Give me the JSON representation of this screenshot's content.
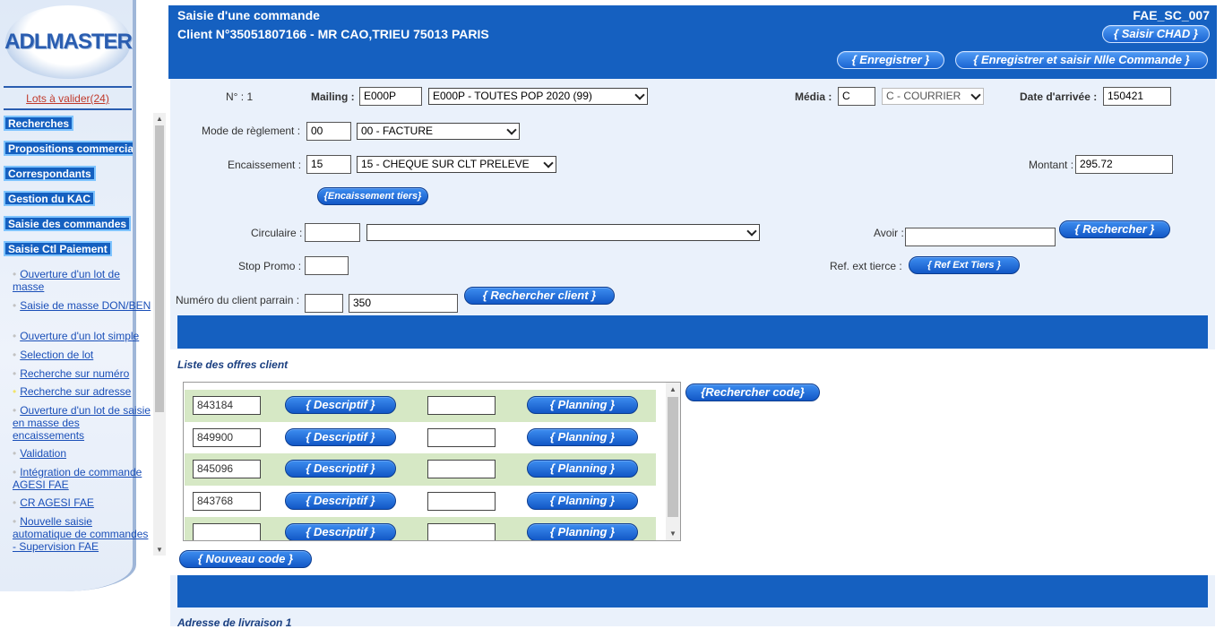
{
  "sidebar": {
    "logo_text": "ADLMASTER",
    "lots_link": "Lots à valider(24)",
    "buttons": [
      "Recherches",
      "Propositions commerciales",
      "Correspondants",
      "Gestion du KAC",
      "Saisie des commandes",
      "Saisie Ctl Paiement"
    ],
    "links": [
      "Ouverture d'un lot de masse",
      "Saisie de masse DON/BEN",
      "Ouverture d'un lot simple",
      "Selection de lot",
      "Recherche sur numéro",
      "Recherche sur adresse",
      "Ouverture d'un lot de saisie en masse des encaissements",
      "Validation",
      "Intégration de commande AGESI FAE",
      "CR AGESI FAE",
      "Nouvelle saisie automatique de commandes - Supervision FAE"
    ]
  },
  "header": {
    "title": "Saisie d'une commande",
    "client": "Client N°35051807166 - MR CAO,TRIEU 75013 PARIS",
    "screen_code": "FAE_SC_007",
    "btn_chad": "{ Saisir CHAD }",
    "btn_save": "{ Enregistrer }",
    "btn_save_new": "{ Enregistrer et saisir Nlle Commande }"
  },
  "form": {
    "num_label": "N° : 1",
    "mailing_label": "Mailing :",
    "mailing_value": "E000P",
    "mailing_select": "E000P - TOUTES POP 2020 (99)",
    "media_label": "Média :",
    "media_value": "C",
    "media_select": "C - COURRIER",
    "date_label": "Date d'arrivée :",
    "date_value": "150421",
    "mode_label": "Mode de règlement :",
    "mode_value": "00",
    "mode_select": "00 - FACTURE",
    "enc_label": "Encaissement :",
    "enc_value": "15",
    "enc_select": "15 - CHEQUE SUR CLT PRELEVE",
    "montant_label": "Montant :",
    "montant_value": "295.72",
    "btn_enc_tiers": "{Encaissement tiers}",
    "circ_label": "Circulaire :",
    "circ_value": "",
    "circ_select": "",
    "avoir_label": "Avoir :",
    "avoir_value": "",
    "btn_rechercher": "{ Rechercher }",
    "stop_label": "Stop Promo :",
    "stop_value": "",
    "ref_label": "Ref. ext tierce :",
    "btn_ref": "{ Ref Ext Tiers }",
    "parrain_label": "Numéro du client parrain :",
    "parrain_value1": "",
    "parrain_value2": "350",
    "btn_rech_client": "{ Rechercher client }"
  },
  "offers": {
    "title": "Liste des offres client",
    "rows": [
      {
        "code": "843184",
        "desc": "{ Descriptif }",
        "plan": "{ Planning }"
      },
      {
        "code": "849900",
        "desc": "{ Descriptif }",
        "plan": "{ Planning }"
      },
      {
        "code": "845096",
        "desc": "{ Descriptif }",
        "plan": "{ Planning }"
      },
      {
        "code": "843768",
        "desc": "{ Descriptif }",
        "plan": "{ Planning }"
      },
      {
        "code": "",
        "desc": "{ Descriptif }",
        "plan": "{ Planning }"
      }
    ],
    "btn_rech_code": "{Rechercher code}",
    "btn_nouveau": "{ Nouveau code }"
  },
  "address": {
    "title": "Adresse de livraison 1"
  }
}
